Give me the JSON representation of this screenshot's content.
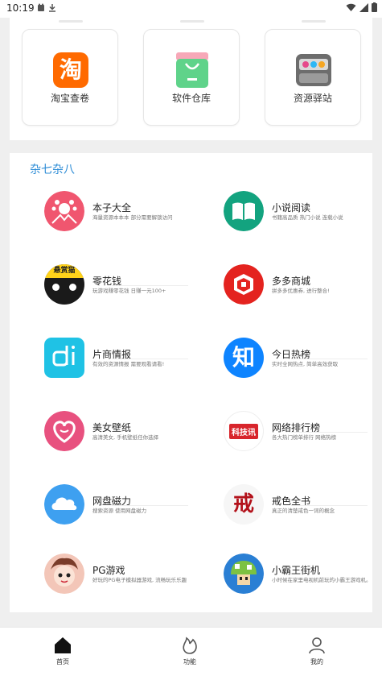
{
  "status": {
    "time": "10:19"
  },
  "top_tiles": [
    {
      "label": "淘宝查卷",
      "icon": "taobao-icon",
      "glyph": "淘"
    },
    {
      "label": "软件仓库",
      "icon": "shopping-bag-icon"
    },
    {
      "label": "资源驿站",
      "icon": "camera-box-icon"
    }
  ],
  "section": {
    "title": "杂七杂八"
  },
  "items": [
    {
      "name": "本子大全",
      "desc": "海量资源本本本 部分需要解锁访问",
      "icon": "paw-icon"
    },
    {
      "name": "小说阅读",
      "desc": "书籍高品质 热门小说 连载小说",
      "icon": "book-icon"
    },
    {
      "name": "零花钱",
      "desc": "玩游戏赚零花钱 日赚一元100+",
      "icon": "cat-coin-icon",
      "badge": "悬赏猫"
    },
    {
      "name": "多多商城",
      "desc": "拼多多优惠券, 进行整合!",
      "icon": "pinduoduo-icon"
    },
    {
      "name": "片商情报",
      "desc": "有效的资源情报 需要观看请看!",
      "icon": "di-icon"
    },
    {
      "name": "今日热榜",
      "desc": "实时全网热点, 简单高效获取",
      "icon": "zhihu-icon",
      "glyph": "知"
    },
    {
      "name": "美女壁纸",
      "desc": "高清美女, 手机壁纸任你选择",
      "icon": "heart-icon"
    },
    {
      "name": "网络排行榜",
      "desc": "各大热门榜单排行 网络热榜",
      "icon": "tech-news-icon",
      "badge": "科技讯"
    },
    {
      "name": "网盘磁力",
      "desc": "搜索资源 使用网盘磁力",
      "icon": "cloud-icon"
    },
    {
      "name": "戒色全书",
      "desc": "真正的清楚戒色一词的概念",
      "icon": "abstain-icon",
      "glyph": "戒"
    },
    {
      "name": "PG游戏",
      "desc": "好玩的PG电子模拟器游戏, 流畅玩乐乐趣",
      "icon": "pg-game-icon"
    },
    {
      "name": "小霸王街机",
      "desc": "小时候在家里电视机前玩的小霸王游戏机。",
      "icon": "mushroom-icon"
    }
  ],
  "nav": [
    {
      "label": "首页",
      "icon": "home-icon"
    },
    {
      "label": "功能",
      "icon": "flame-icon"
    },
    {
      "label": "我的",
      "icon": "user-icon"
    }
  ]
}
